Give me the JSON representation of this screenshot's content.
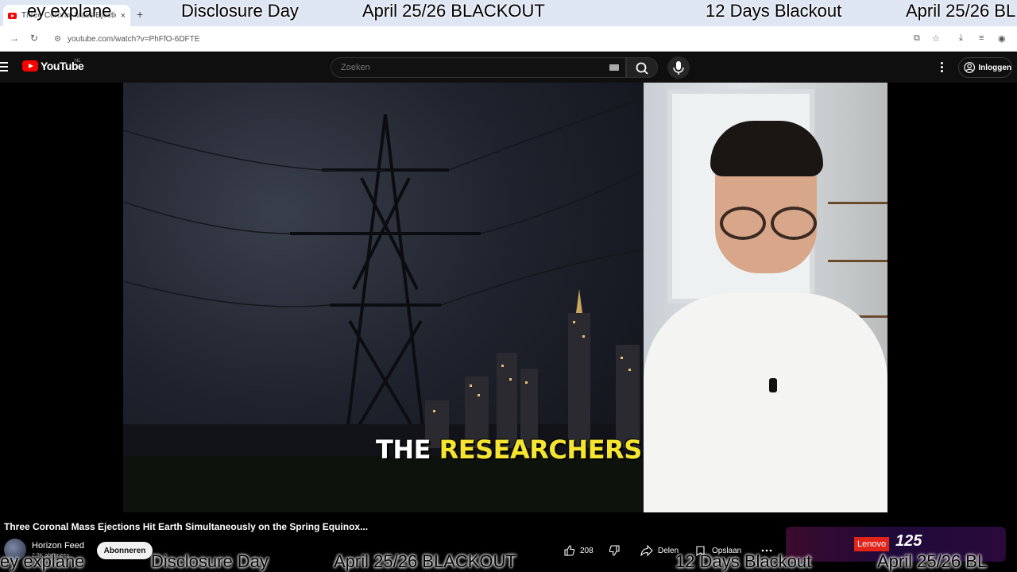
{
  "browser": {
    "tab_title": "Three Coronal Mass Ejectio...",
    "url": "youtube.com/watch?v=PhFfO-6DFTE",
    "new_tab_symbol": "+",
    "close_symbol": "×"
  },
  "youtube": {
    "logo_text": "YouTube",
    "region": "NL",
    "search_placeholder": "Zoeken",
    "signin_label": "Inloggen"
  },
  "video": {
    "caption_white": "THE",
    "caption_yellow": "RESEARCHERS"
  },
  "info": {
    "title": "Three Coronal Mass Ejections Hit Earth Simultaneously on the Spring Equinox...",
    "channel_name": "Horizon Feed",
    "subscriber_count": "2,8K abonnees",
    "subscribe_label": "Abonneren",
    "like_count": "208",
    "share_label": "Delen",
    "save_label": "Opslaan"
  },
  "ad": {
    "brand": "Lenovo",
    "badge": "125"
  },
  "overlay_ticker": {
    "top": [
      "ey explane",
      "Disclosure Day",
      "April 25/26 BLACKOUT",
      "12 Days Blackout",
      "April 25/26 BL"
    ],
    "bottom": [
      "ey explane",
      "Disclosure Day",
      "April 25/26 BLACKOUT",
      "12 Days Blackout",
      "April 25/26 BL"
    ]
  },
  "colors": {
    "yt_red": "#ff0000",
    "caption_yellow": "#f5e530",
    "lenovo_red": "#e2231a"
  }
}
